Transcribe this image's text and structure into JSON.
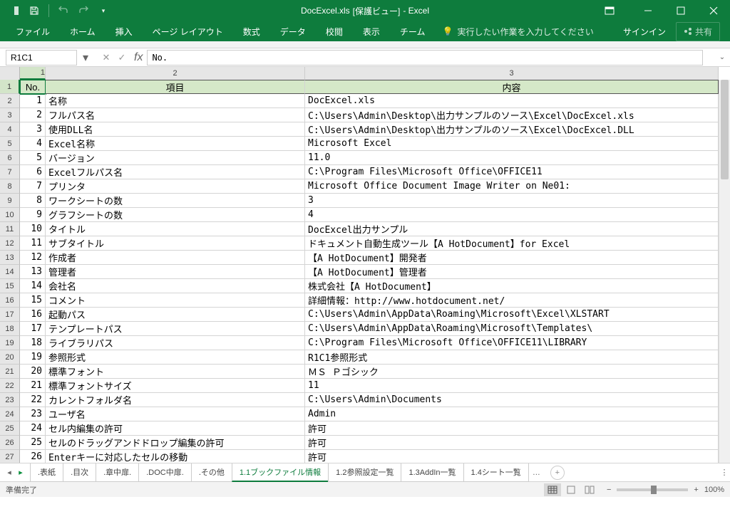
{
  "window": {
    "title_doc": "DocExcel.xls",
    "title_mode": "[保護ビュー]",
    "title_app": "- Excel"
  },
  "ribbon": {
    "tabs": [
      "ファイル",
      "ホーム",
      "挿入",
      "ページ レイアウト",
      "数式",
      "データ",
      "校閲",
      "表示",
      "チーム"
    ],
    "tell_me": "実行したい作業を入力してください",
    "signin": "サインイン",
    "share": "共有"
  },
  "formula_bar": {
    "name_box": "R1C1",
    "formula": "No."
  },
  "columns": [
    "1",
    "2",
    "3"
  ],
  "header_row": {
    "no": "No.",
    "item": "項目",
    "content": "内容"
  },
  "rows": [
    {
      "n": "1",
      "item": "名称",
      "content": "DocExcel.xls"
    },
    {
      "n": "2",
      "item": "フルパス名",
      "content": "C:\\Users\\Admin\\Desktop\\出力サンプルのソース\\Excel\\DocExcel.xls"
    },
    {
      "n": "3",
      "item": "使用DLL名",
      "content": "C:\\Users\\Admin\\Desktop\\出力サンプルのソース\\Excel\\DocExcel.DLL"
    },
    {
      "n": "4",
      "item": "Excel名称",
      "content": "Microsoft Excel"
    },
    {
      "n": "5",
      "item": "バージョン",
      "content": "11.0"
    },
    {
      "n": "6",
      "item": "Excelフルパス名",
      "content": "C:\\Program Files\\Microsoft Office\\OFFICE11"
    },
    {
      "n": "7",
      "item": "プリンタ",
      "content": "Microsoft Office Document Image Writer on Ne01:"
    },
    {
      "n": "8",
      "item": "ワークシートの数",
      "content": "3"
    },
    {
      "n": "9",
      "item": "グラフシートの数",
      "content": "4"
    },
    {
      "n": "10",
      "item": "タイトル",
      "content": "DocExcel出力サンプル"
    },
    {
      "n": "11",
      "item": "サブタイトル",
      "content": "ドキュメント自動生成ツール【A HotDocument】for Excel"
    },
    {
      "n": "12",
      "item": "作成者",
      "content": "【A HotDocument】開発者"
    },
    {
      "n": "13",
      "item": "管理者",
      "content": "【A HotDocument】管理者"
    },
    {
      "n": "14",
      "item": "会社名",
      "content": "株式会社【A HotDocument】"
    },
    {
      "n": "15",
      "item": "コメント",
      "content": "詳細情報：http://www.hotdocument.net/"
    },
    {
      "n": "16",
      "item": "起動パス",
      "content": "C:\\Users\\Admin\\AppData\\Roaming\\Microsoft\\Excel\\XLSTART"
    },
    {
      "n": "17",
      "item": "テンプレートパス",
      "content": "C:\\Users\\Admin\\AppData\\Roaming\\Microsoft\\Templates\\"
    },
    {
      "n": "18",
      "item": "ライブラリパス",
      "content": "C:\\Program Files\\Microsoft Office\\OFFICE11\\LIBRARY"
    },
    {
      "n": "19",
      "item": "参照形式",
      "content": "R1C1参照形式"
    },
    {
      "n": "20",
      "item": "標準フォント",
      "content": "ＭＳ Ｐゴシック"
    },
    {
      "n": "21",
      "item": "標準フォントサイズ",
      "content": "11"
    },
    {
      "n": "22",
      "item": "カレントフォルダ名",
      "content": "C:\\Users\\Admin\\Documents"
    },
    {
      "n": "23",
      "item": "ユーザ名",
      "content": "Admin"
    },
    {
      "n": "24",
      "item": "セル内編集の許可",
      "content": "許可"
    },
    {
      "n": "25",
      "item": "セルのドラッグアンドドロップ編集の許可",
      "content": "許可"
    },
    {
      "n": "26",
      "item": "Enterキーに対応したセルの移動",
      "content": "許可"
    }
  ],
  "sheet_tabs": [
    ".表紙",
    ".目次",
    ".章中扉.",
    ".DOC中扉.",
    ".その他",
    "1.1ブックファイル情報",
    "1.2参照設定一覧",
    "1.3AddIn一覧",
    "1.4シート一覧"
  ],
  "active_sheet_index": 5,
  "status": {
    "ready": "準備完了",
    "zoom": "100%"
  }
}
